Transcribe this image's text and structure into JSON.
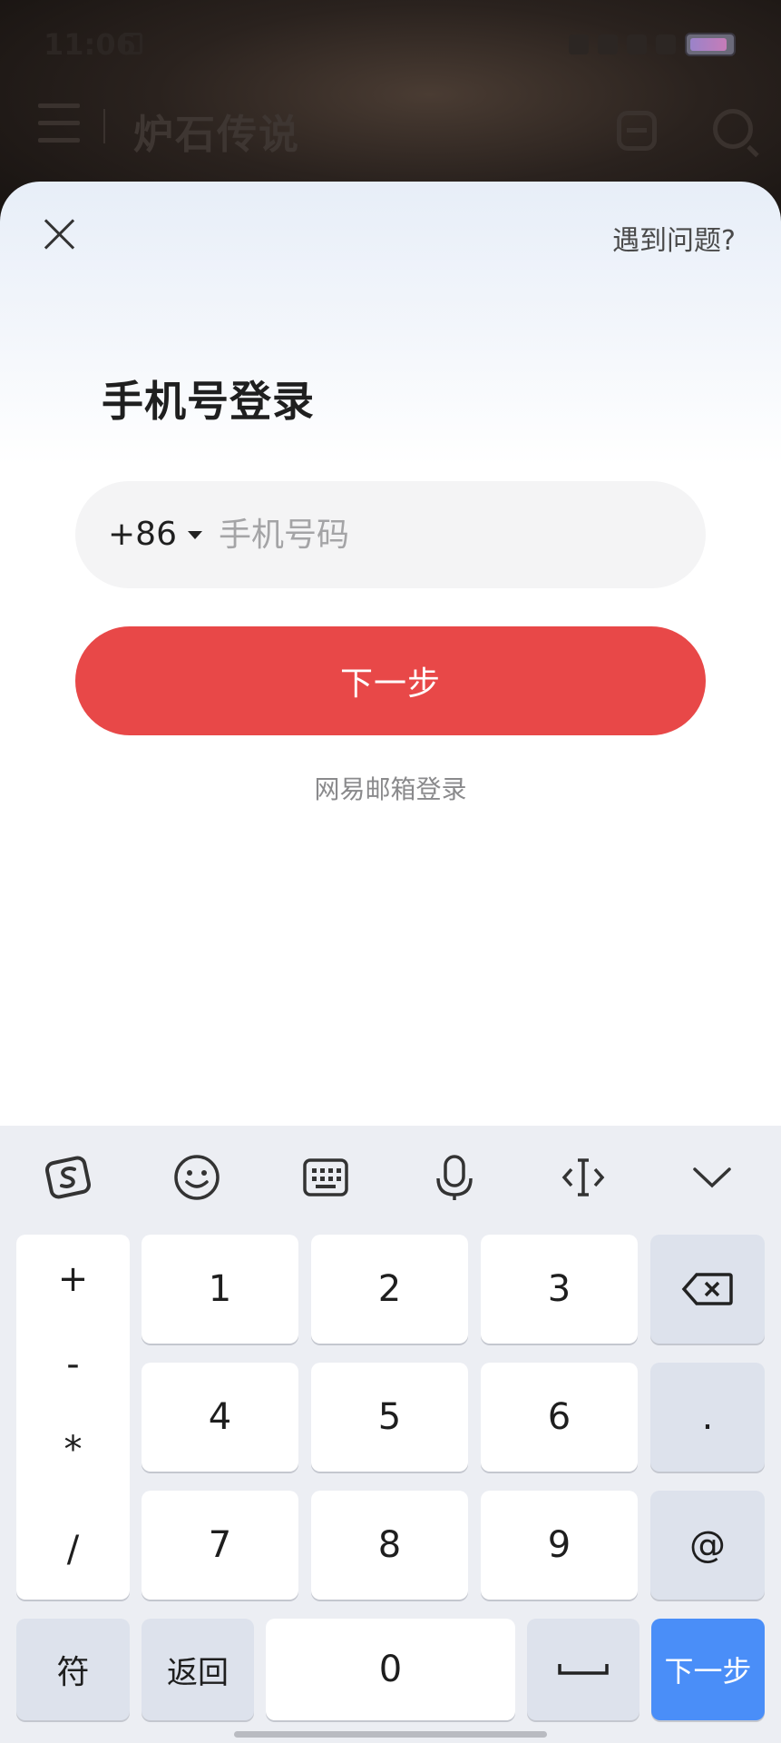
{
  "status_bar": {
    "time": "11:06"
  },
  "header": {
    "title": "炉石传说"
  },
  "login": {
    "help_label": "遇到问题?",
    "title": "手机号登录",
    "country_code": "+86",
    "phone_placeholder": "手机号码",
    "next_label": "下一步",
    "email_login_label": "网易邮箱登录"
  },
  "keyboard": {
    "toolbar": [
      "sogou-logo-icon",
      "emoji-icon",
      "keyboard-icon",
      "microphone-icon",
      "cursor-icon",
      "collapse-chevron-icon"
    ],
    "symbols": [
      "+",
      "-",
      "*",
      "/"
    ],
    "digits": [
      "1",
      "2",
      "3",
      "4",
      "5",
      "6",
      "7",
      "8",
      "9",
      "0"
    ],
    "dot": ".",
    "at": "@",
    "sym_label": "符",
    "back_label": "返回",
    "space_label": "␣",
    "enter_label": "下一步"
  },
  "colors": {
    "primary_button": "#e84848",
    "enter_key": "#4a8ef8",
    "input_bg": "#f4f4f5",
    "keyboard_bg": "#eceef3"
  }
}
